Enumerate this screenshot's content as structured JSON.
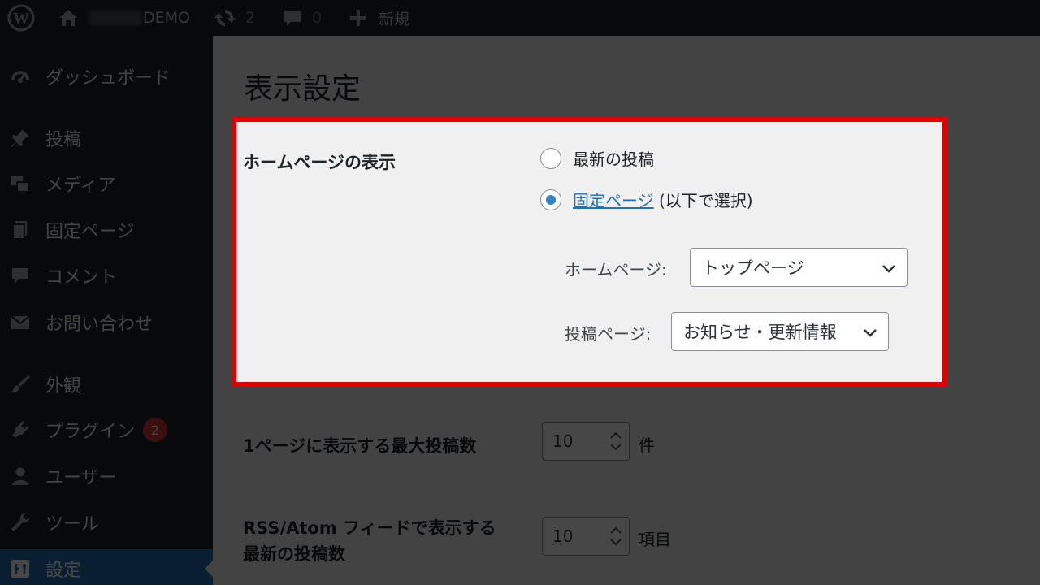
{
  "adminbar": {
    "site_name": "DEMO",
    "updates_count": "2",
    "comments_count": "0",
    "new_label": "新規"
  },
  "sidebar": {
    "items": [
      {
        "label": "ダッシュボード",
        "icon": "dashboard-icon"
      },
      {
        "label": "投稿",
        "icon": "pushpin-icon"
      },
      {
        "label": "メディア",
        "icon": "media-icon"
      },
      {
        "label": "固定ページ",
        "icon": "page-icon"
      },
      {
        "label": "コメント",
        "icon": "comment-icon"
      },
      {
        "label": "お問い合わせ",
        "icon": "mail-icon"
      },
      {
        "label": "外観",
        "icon": "brush-icon"
      },
      {
        "label": "プラグイン",
        "icon": "plugin-icon",
        "badge": "2"
      },
      {
        "label": "ユーザー",
        "icon": "user-icon"
      },
      {
        "label": "ツール",
        "icon": "wrench-icon"
      },
      {
        "label": "設定",
        "icon": "settings-icon"
      }
    ]
  },
  "page": {
    "title": "表示設定"
  },
  "homepage_display": {
    "label": "ホームページの表示",
    "option_latest": "最新の投稿",
    "option_static_link": "固定ページ",
    "option_static_suffix": " (以下で選択)",
    "homepage_label": "ホームページ:",
    "homepage_value": "トップページ",
    "postspage_label": "投稿ページ:",
    "postspage_value": "お知らせ・更新情報"
  },
  "posts_per_page": {
    "label": "1ページに表示する最大投稿数",
    "value": "10",
    "unit": "件"
  },
  "feed_posts": {
    "label_line1": "RSS/Atom フィードで表示する",
    "label_line2": "最新の投稿数",
    "value": "10",
    "unit": "項目"
  },
  "colors": {
    "highlight": "#e00000",
    "accent": "#2271b1",
    "badge": "#d63638"
  }
}
